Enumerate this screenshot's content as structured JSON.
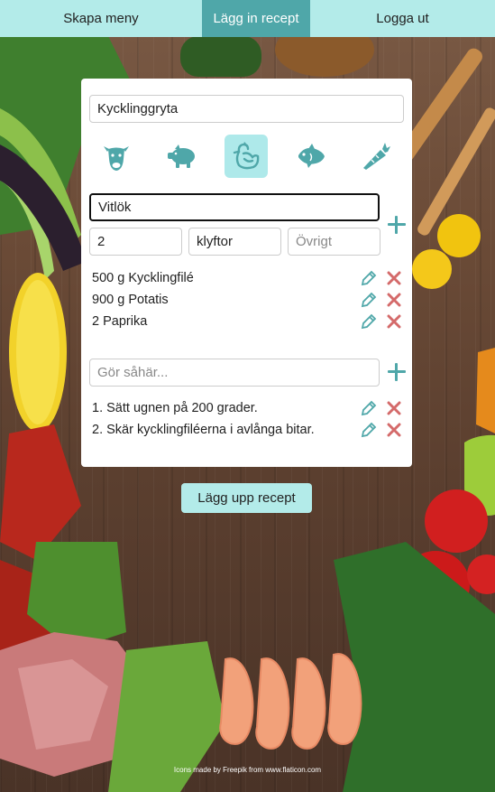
{
  "nav": {
    "items": [
      {
        "label": "Skapa meny",
        "active": false
      },
      {
        "label": "Lägg in recept",
        "active": true
      },
      {
        "label": "Logga ut",
        "active": false
      }
    ]
  },
  "recipe": {
    "title_value": "Kycklinggryta",
    "categories": [
      {
        "icon": "cow-icon",
        "active": false
      },
      {
        "icon": "pig-icon",
        "active": false
      },
      {
        "icon": "chicken-icon",
        "active": true
      },
      {
        "icon": "fish-icon",
        "active": false
      },
      {
        "icon": "carrot-icon",
        "active": false
      }
    ],
    "ingredient_input": {
      "name_value": "Vitlök",
      "amount_value": "2",
      "unit_value": "klyftor",
      "other_placeholder": "Övrigt"
    },
    "ingredients": [
      {
        "text": "500 g Kycklingfilé"
      },
      {
        "text": "900 g Potatis"
      },
      {
        "text": "2 Paprika"
      }
    ],
    "step_input": {
      "placeholder": "Gör såhär..."
    },
    "steps": [
      {
        "text": "1. Sätt ugnen på 200 grader."
      },
      {
        "text": "2. Skär kycklingfiléerna i avlånga bitar."
      }
    ]
  },
  "submit_label": "Lägg upp recept",
  "credit": "Icons made by Freepik from www.flaticon.com",
  "colors": {
    "accent": "#4fa7a9",
    "accent_light": "#b3ebe9",
    "delete": "#d46a6a"
  }
}
